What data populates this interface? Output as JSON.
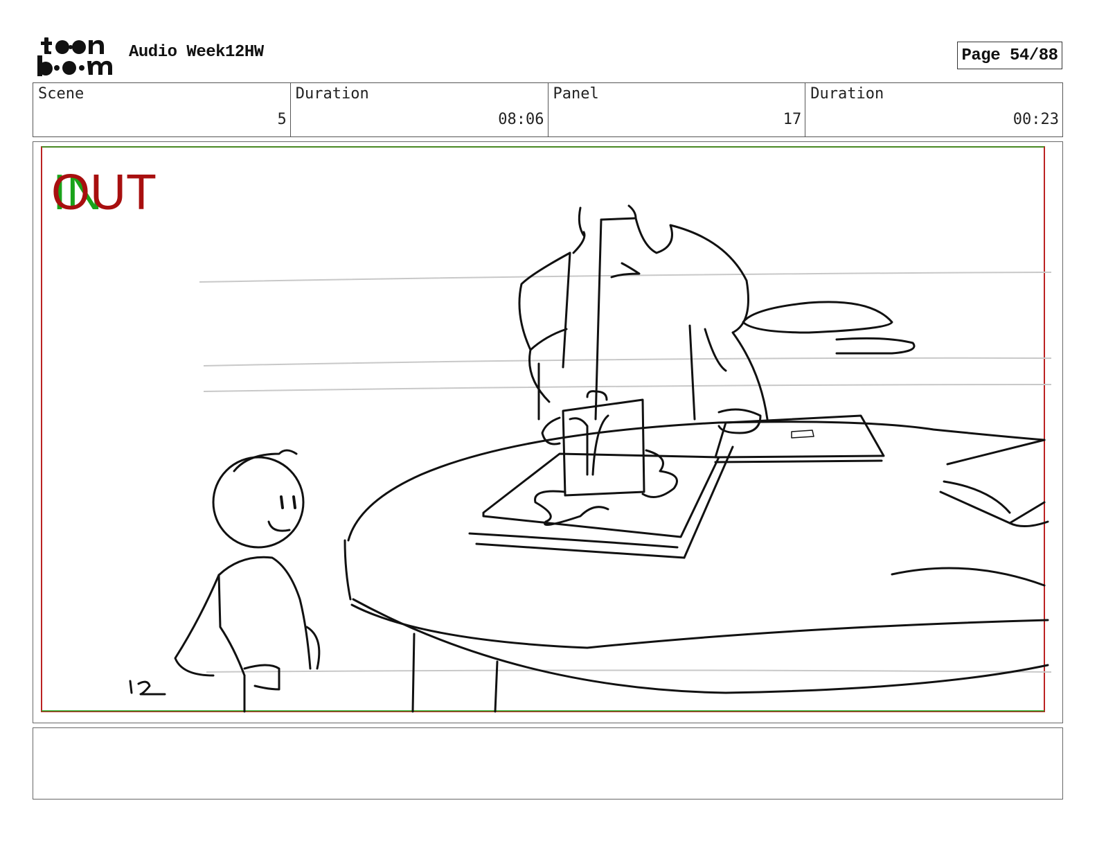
{
  "header": {
    "logo_icon": "toonboom-logo",
    "document_title": "Audio Week12HW",
    "page_label": "Page 54/88"
  },
  "info": {
    "scene_label": "Scene",
    "scene_value": "5",
    "scene_duration_label": "Duration",
    "scene_duration_value": "08:06",
    "panel_label": "Panel",
    "panel_value": "17",
    "panel_duration_label": "Duration",
    "panel_duration_value": "00:23"
  },
  "panel": {
    "in_marker": "IN",
    "out_marker": "OUT",
    "sketch_number": "12",
    "in_color": "#1aa31a",
    "out_color": "#a80f0f"
  },
  "caption": {
    "text": ""
  }
}
